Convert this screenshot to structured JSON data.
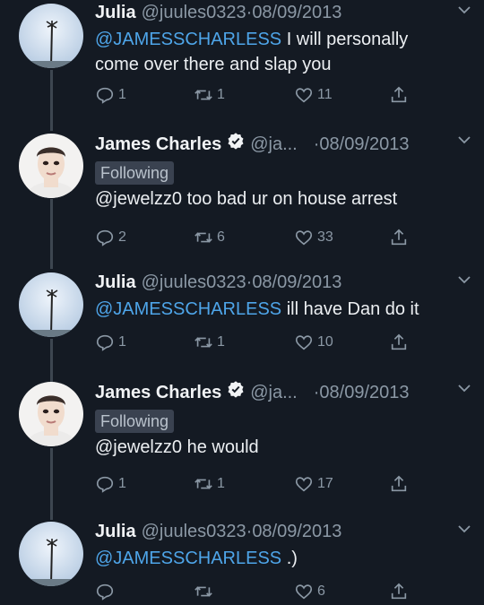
{
  "tweets": [
    {
      "name": "Julia",
      "handle": "@juules0323",
      "sep": "·",
      "date": "08/09/2013",
      "mention": "@JAMESSCHARLESS",
      "text_line1": " I will personally",
      "text_line2": "come over there and slap you",
      "replies": "1",
      "retweets": "1",
      "likes": "11"
    },
    {
      "name": "James Charles",
      "handle": "@ja...",
      "sep": "·",
      "date": "08/09/2013",
      "following": "Following",
      "mention": "@jewelzz0",
      "text": " too bad ur on house arrest",
      "replies": "2",
      "retweets": "6",
      "likes": "33"
    },
    {
      "name": "Julia",
      "handle": "@juules0323",
      "sep": "·",
      "date": "08/09/2013",
      "mention": "@JAMESSCHARLESS",
      "text": " ill have Dan do it",
      "replies": "1",
      "retweets": "1",
      "likes": "10"
    },
    {
      "name": "James Charles",
      "handle": "@ja...",
      "sep": "·",
      "date": "08/09/2013",
      "following": "Following",
      "mention": "@jewelzz0",
      "text": " he would",
      "replies": "1",
      "retweets": "1",
      "likes": "17"
    },
    {
      "name": "Julia",
      "handle": "@juules0323",
      "sep": "·",
      "date": "08/09/2013",
      "mention": "@JAMESSCHARLESS",
      "text": " .)",
      "replies": "",
      "retweets": "",
      "likes": "6"
    }
  ],
  "icons": {
    "reply": "reply-icon",
    "retweet": "retweet-icon",
    "like": "heart-icon",
    "share": "share-icon",
    "more": "chevron-down-icon",
    "verified": "verified-badge-icon"
  },
  "colors": {
    "background": "#141a23",
    "mention": "#4ea5e9",
    "muted": "#8b98a5",
    "verified": "#1da1f2"
  }
}
